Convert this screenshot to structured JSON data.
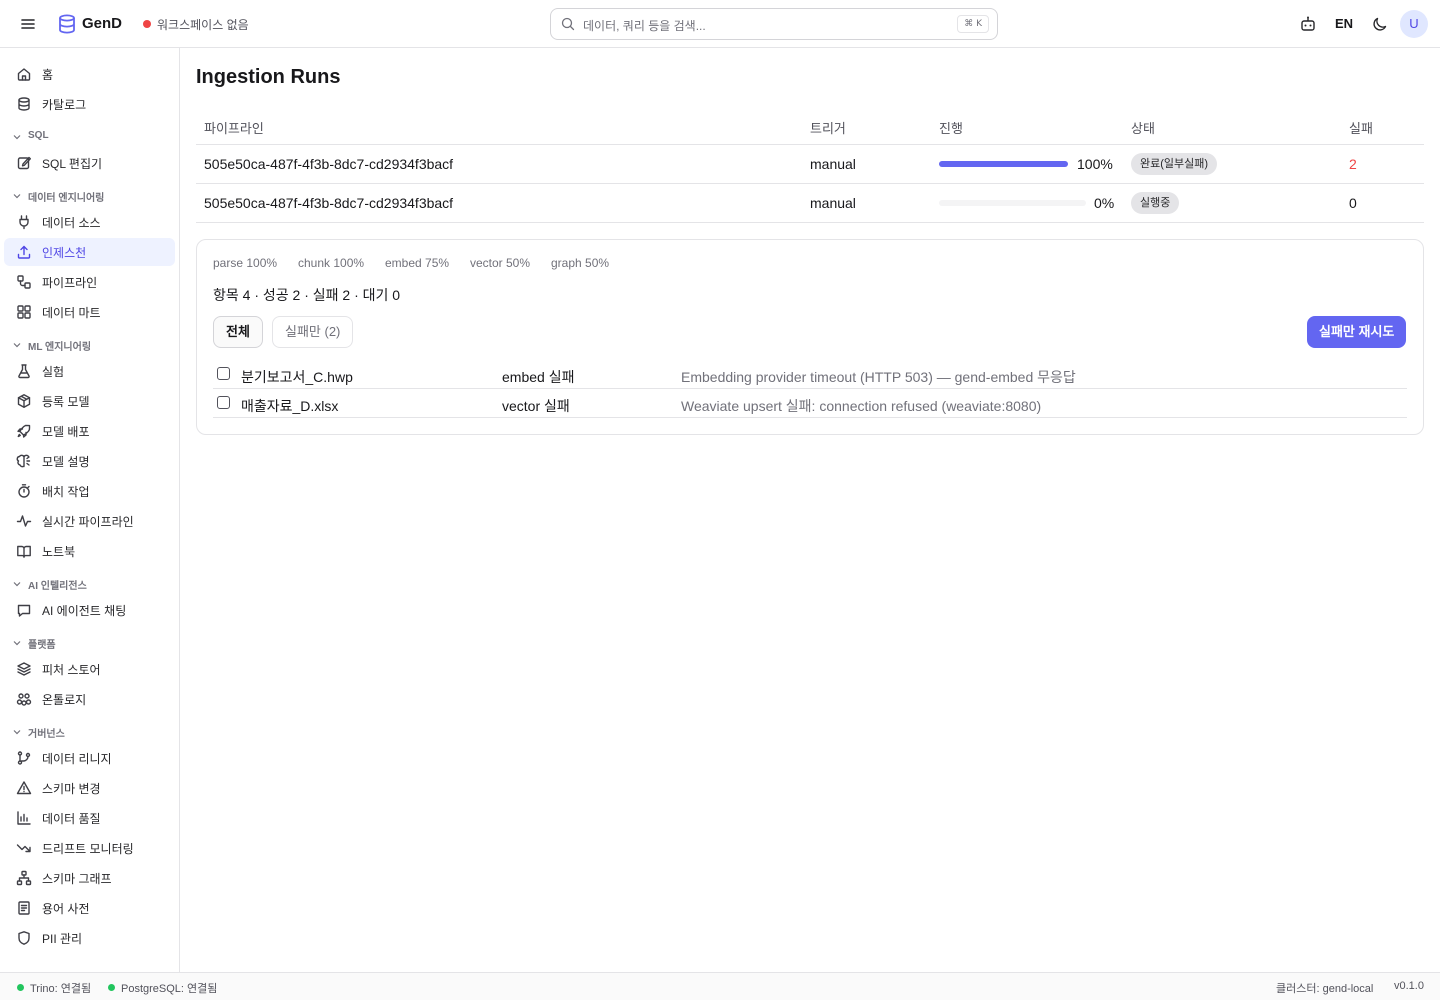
{
  "header": {
    "app_name": "GenD",
    "workspace_status": "워크스페이스 없음",
    "search_placeholder": "데이터, 쿼리 등을 검색...",
    "search_shortcut": "⌘ K",
    "lang": "EN",
    "avatar_initial": "U"
  },
  "sidebar": {
    "top": [
      {
        "label": "홈",
        "icon": "home-icon"
      },
      {
        "label": "카탈로그",
        "icon": "database-icon"
      }
    ],
    "sections": [
      {
        "title": "SQL",
        "items": [
          {
            "label": "SQL 편집기",
            "icon": "edit-icon"
          }
        ]
      },
      {
        "title": "데이터 엔지니어링",
        "items": [
          {
            "label": "데이터 소스",
            "icon": "plug-icon"
          },
          {
            "label": "인제스천",
            "icon": "upload-icon",
            "active": true
          },
          {
            "label": "파이프라인",
            "icon": "workflow-icon"
          },
          {
            "label": "데이터 마트",
            "icon": "grid-icon"
          }
        ]
      },
      {
        "title": "ML 엔지니어링",
        "items": [
          {
            "label": "실험",
            "icon": "flask-icon"
          },
          {
            "label": "등록 모델",
            "icon": "package-icon"
          },
          {
            "label": "모델 배포",
            "icon": "rocket-icon"
          },
          {
            "label": "모델 설명",
            "icon": "brain-icon"
          },
          {
            "label": "배치 작업",
            "icon": "timer-icon"
          },
          {
            "label": "실시간 파이프라인",
            "icon": "activity-icon"
          },
          {
            "label": "노트북",
            "icon": "book-icon"
          }
        ]
      },
      {
        "title": "AI 인텔리전스",
        "items": [
          {
            "label": "AI 에이전트 채팅",
            "icon": "chat-icon"
          }
        ]
      },
      {
        "title": "플랫폼",
        "items": [
          {
            "label": "피처 스토어",
            "icon": "layers-icon"
          },
          {
            "label": "온톨로지",
            "icon": "ontology-icon"
          }
        ]
      },
      {
        "title": "거버넌스",
        "items": [
          {
            "label": "데이터 리니지",
            "icon": "git-branch-icon"
          },
          {
            "label": "스키마 변경",
            "icon": "warning-icon"
          },
          {
            "label": "데이터 품질",
            "icon": "bar-chart-icon"
          },
          {
            "label": "드리프트 모니터링",
            "icon": "trend-down-icon"
          },
          {
            "label": "스키마 그래프",
            "icon": "network-icon"
          },
          {
            "label": "용어 사전",
            "icon": "glossary-icon"
          },
          {
            "label": "PII 관리",
            "icon": "shield-icon"
          }
        ]
      }
    ]
  },
  "main": {
    "title": "Ingestion Runs",
    "columns": [
      "파이프라인",
      "트리거",
      "진행",
      "상태",
      "실패"
    ],
    "runs": [
      {
        "pipeline": "505e50ca-487f-4f3b-8dc7-cd2934f3bacf",
        "trigger": "manual",
        "progress": 1.0,
        "progress_label": "100%",
        "status": "완료(일부실패)",
        "failed": "2"
      },
      {
        "pipeline": "505e50ca-487f-4f3b-8dc7-cd2934f3bacf",
        "trigger": "manual",
        "progress": 0.0,
        "progress_label": "0%",
        "status": "실행중",
        "failed": "0"
      }
    ],
    "detail": {
      "stages": [
        "parse 100%",
        "chunk 100%",
        "embed 75%",
        "vector 50%",
        "graph 50%"
      ],
      "summary": "항목 4 · 성공 2 · 실패 2 · 대기 0",
      "filter_all": "전체",
      "filter_failed": "실패만 (2)",
      "retry_button": "실패만 재시도",
      "failures": [
        {
          "file": "분기보고서_C.hwp",
          "stage": "embed 실패",
          "error": "Embedding provider timeout (HTTP 503) — gend-embed 무응답"
        },
        {
          "file": "매출자료_D.xlsx",
          "stage": "vector 실패",
          "error": "Weaviate upsert 실패: connection refused (weaviate:8080)"
        }
      ]
    }
  },
  "statusbar": {
    "trino": "Trino: 연결됨",
    "postgres": "PostgreSQL: 연결됨",
    "cluster": "클러스터: gend-local",
    "version": "v0.1.0"
  },
  "colors": {
    "accent": "#6366f1",
    "failed_count": "#ef4444",
    "connected": "#22c55e"
  }
}
